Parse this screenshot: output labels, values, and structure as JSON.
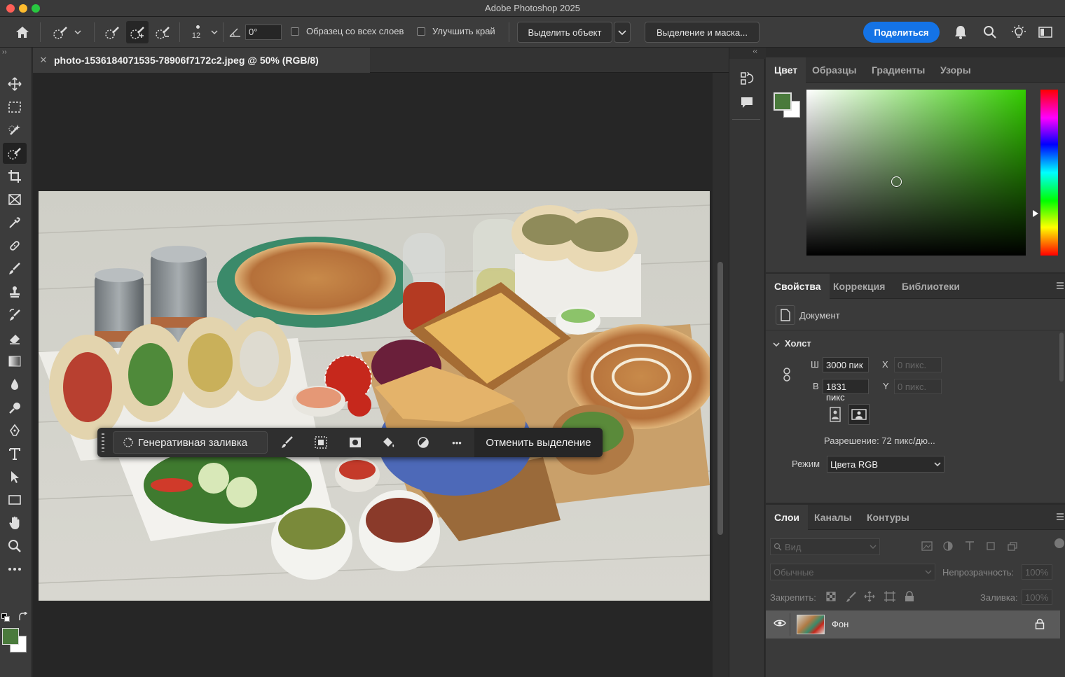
{
  "window": {
    "title": "Adobe Photoshop 2025"
  },
  "options_bar": {
    "brush_size": "12",
    "angle_value": "0°",
    "sample_all_layers_label": "Образец со всех слоев",
    "enhance_edge_label": "Улучшить край",
    "select_subject_label": "Выделить объект",
    "select_and_mask_label": "Выделение и маска...",
    "share_label": "Поделиться"
  },
  "document": {
    "tab_title": "photo-1536184071535-78906f7172c2.jpeg @ 50% (RGB/8)"
  },
  "context_bar": {
    "generative_fill_label": "Генеративная заливка",
    "more_label": "•••",
    "deselect_label": "Отменить выделение"
  },
  "color_panel": {
    "tabs": [
      "Цвет",
      "Образцы",
      "Градиенты",
      "Узоры"
    ],
    "foreground_color": "#4a7a3c",
    "background_color": "#ffffff",
    "hue_color": "#33cc00"
  },
  "properties_panel": {
    "tabs": [
      "Свойства",
      "Коррекция",
      "Библиотеки"
    ],
    "doc_label": "Документ",
    "canvas_section": "Холст",
    "width_label": "Ш",
    "width_value": "3000 пик",
    "height_label": "В",
    "height_value": "1831 пикс",
    "x_label": "X",
    "x_placeholder": "0 пикс.",
    "y_label": "Y",
    "y_placeholder": "0 пикс.",
    "resolution_text": "Разрешение: 72 пикс/дю...",
    "mode_label": "Режим",
    "mode_value": "Цвета RGB"
  },
  "layers_panel": {
    "tabs": [
      "Слои",
      "Каналы",
      "Контуры"
    ],
    "search_placeholder": "Вид",
    "blend_mode": "Обычные",
    "opacity_label": "Непрозрачность:",
    "opacity_value": "100%",
    "lock_label": "Закрепить:",
    "fill_label": "Заливка:",
    "fill_value": "100%",
    "layers": [
      {
        "name": "Фон"
      }
    ]
  },
  "accent_color": "#1473e6"
}
